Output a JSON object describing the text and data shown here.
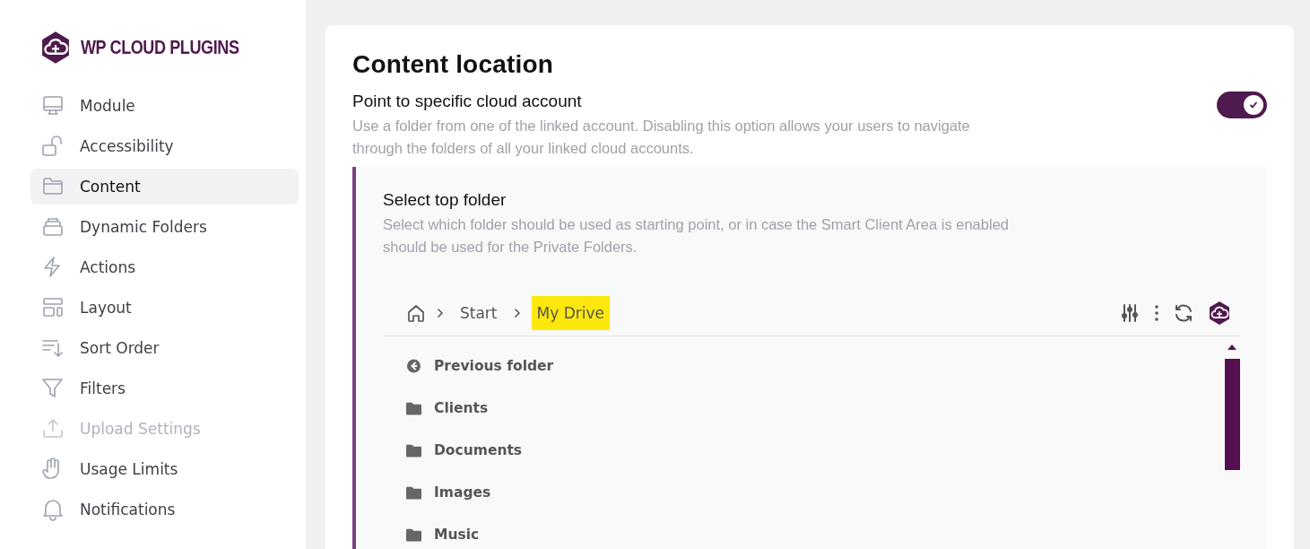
{
  "brand": {
    "name": "WP CLOUD PLUGINS"
  },
  "sidebar": {
    "items": [
      {
        "label": "Module",
        "kind": "monitor",
        "selected": false,
        "disabled": false
      },
      {
        "label": "Accessibility",
        "kind": "lock",
        "selected": false,
        "disabled": false
      },
      {
        "label": "Content",
        "kind": "folder",
        "selected": true,
        "disabled": false
      },
      {
        "label": "Dynamic Folders",
        "kind": "stack",
        "selected": false,
        "disabled": false
      },
      {
        "label": "Actions",
        "kind": "bolt",
        "selected": false,
        "disabled": false
      },
      {
        "label": "Layout",
        "kind": "layout",
        "selected": false,
        "disabled": false
      },
      {
        "label": "Sort Order",
        "kind": "sort",
        "selected": false,
        "disabled": false
      },
      {
        "label": "Filters",
        "kind": "filter",
        "selected": false,
        "disabled": false
      },
      {
        "label": "Upload Settings",
        "kind": "upload",
        "selected": false,
        "disabled": true
      },
      {
        "label": "Usage Limits",
        "kind": "hand",
        "selected": false,
        "disabled": false
      },
      {
        "label": "Notifications",
        "kind": "bell",
        "selected": false,
        "disabled": false
      }
    ]
  },
  "section": {
    "title": "Content location",
    "option": {
      "label": "Point to specific cloud account",
      "description": "Use a folder from one of the linked account. Disabling this option allows your users to navigate through the folders of all your linked cloud accounts.",
      "on": true
    },
    "subsection": {
      "title": "Select top folder",
      "description": "Select which folder should be used as starting point, or in case the Smart Client Area is enabled should be used for the Private Folders.",
      "browser": {
        "breadcrumb": [
          {
            "label": "Start",
            "highlighted": false
          },
          {
            "label": "My Drive",
            "highlighted": true
          }
        ],
        "entries": [
          {
            "label": "Previous folder",
            "kind": "back"
          },
          {
            "label": "Clients",
            "kind": "folder"
          },
          {
            "label": "Documents",
            "kind": "folder"
          },
          {
            "label": "Images",
            "kind": "folder"
          },
          {
            "label": "Music",
            "kind": "folder"
          }
        ]
      }
    }
  }
}
